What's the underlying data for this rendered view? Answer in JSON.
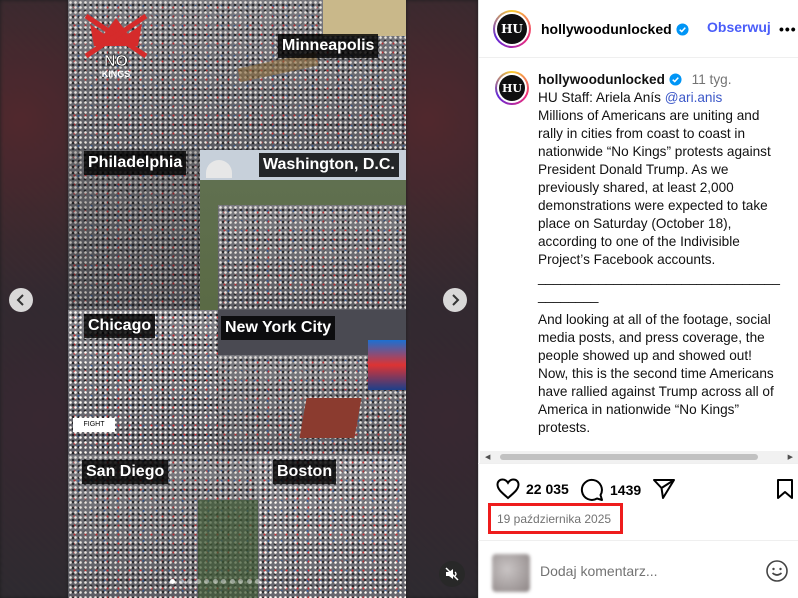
{
  "media": {
    "logo_text_top": "NO",
    "logo_text_bottom": "KINGS",
    "cities": [
      "Minneapolis",
      "Philadelphia",
      "Washington, D.C.",
      "Chicago",
      "New York City",
      "San Diego",
      "Boston"
    ],
    "carousel_dot_count": 11,
    "carousel_active_index": 0
  },
  "post": {
    "username": "hollywoodunlocked",
    "avatar_text": "HU",
    "follow_label": "Obserwuj",
    "more_label": "•••",
    "caption": {
      "username": "hollywoodunlocked",
      "time": "11 tyg.",
      "staff_prefix": "HU Staff: Ariela Anís ",
      "mention": "@ari.anis",
      "paragraph1": "Millions of Americans are uniting and rally in cities from coast to coast in nationwide “No Kings” protests against President Donald Trump. As we previously shared, at least 2,000 demonstrations were expected to take place on Saturday (October 18), according to one of the Indivisible Project’s Facebook accounts.",
      "divider1": "________________________________________",
      "paragraph2": "And looking at all of the footage, social media posts, and press coverage, the people showed up and showed out! Now, this is the second time Americans have rallied against Trump across all of America in nationwide “No Kings” protests.",
      "divider2": "________________________________"
    },
    "likes": "22 035",
    "comments": "1439",
    "date": "19 października 2025",
    "comment_placeholder": "Dodaj komentarz..."
  },
  "colors": {
    "follow": "#4a5df9",
    "highlight_box": "#ee1c1c",
    "verified": "#0095f6"
  }
}
